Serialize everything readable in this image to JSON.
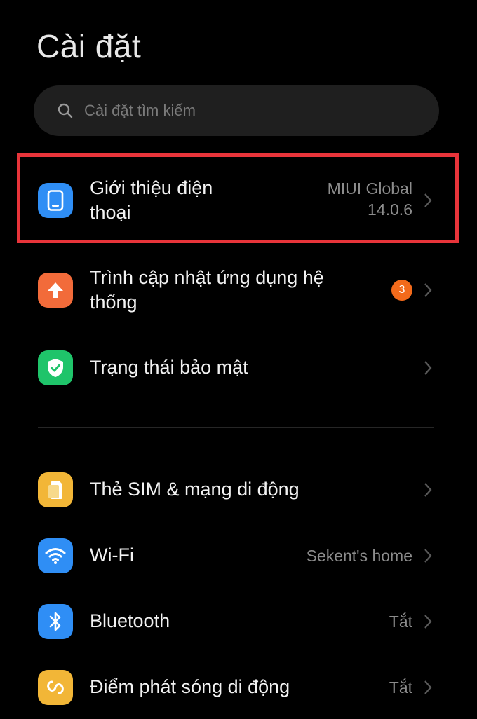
{
  "header": {
    "title": "Cài đặt"
  },
  "search": {
    "placeholder": "Cài đặt tìm kiếm"
  },
  "items": [
    {
      "label_line1": "Giới thiệu điện",
      "label_line2": "thoại",
      "value_line1": "MIUI Global",
      "value_line2": "14.0.6",
      "icon": "phone-icon",
      "color": "#2f8ef5"
    },
    {
      "label_line1": "Trình cập nhật ứng dụng hệ",
      "label_line2": "thống",
      "badge": "3",
      "icon": "arrow-up-icon",
      "color": "#f26b3a"
    },
    {
      "label": "Trạng thái bảo mật",
      "icon": "shield-check-icon",
      "color": "#1fc46a"
    },
    {
      "label": "Thẻ SIM & mạng di động",
      "icon": "sim-card-icon",
      "color": "#f2b637"
    },
    {
      "label": "Wi-Fi",
      "value": "Sekent's home",
      "icon": "wifi-icon",
      "color": "#2f8ef5"
    },
    {
      "label": "Bluetooth",
      "value": "Tắt",
      "icon": "bluetooth-icon",
      "color": "#2f8ef5"
    },
    {
      "label": "Điểm phát sóng di động",
      "value": "Tắt",
      "icon": "hotspot-icon",
      "color": "#f2b637"
    }
  ],
  "colors": {
    "background": "#000000",
    "highlight": "#e8343a",
    "badge": "#f26a1b"
  }
}
